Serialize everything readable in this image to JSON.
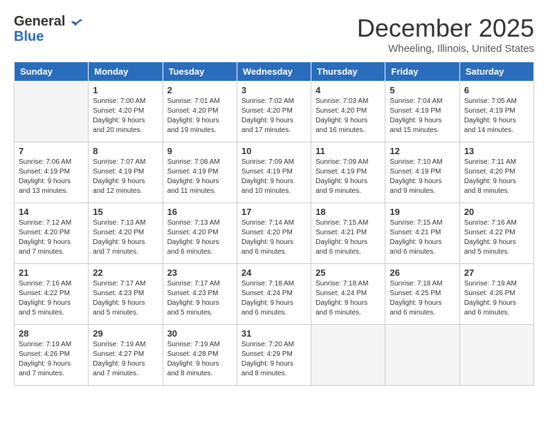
{
  "logo": {
    "general": "General",
    "blue": "Blue"
  },
  "title": "December 2025",
  "location": "Wheeling, Illinois, United States",
  "days_of_week": [
    "Sunday",
    "Monday",
    "Tuesday",
    "Wednesday",
    "Thursday",
    "Friday",
    "Saturday"
  ],
  "weeks": [
    [
      {
        "day": "",
        "empty": true
      },
      {
        "day": "1",
        "sunrise": "7:00 AM",
        "sunset": "4:20 PM",
        "daylight": "9 hours and 20 minutes."
      },
      {
        "day": "2",
        "sunrise": "7:01 AM",
        "sunset": "4:20 PM",
        "daylight": "9 hours and 19 minutes."
      },
      {
        "day": "3",
        "sunrise": "7:02 AM",
        "sunset": "4:20 PM",
        "daylight": "9 hours and 17 minutes."
      },
      {
        "day": "4",
        "sunrise": "7:03 AM",
        "sunset": "4:20 PM",
        "daylight": "9 hours and 16 minutes."
      },
      {
        "day": "5",
        "sunrise": "7:04 AM",
        "sunset": "4:19 PM",
        "daylight": "9 hours and 15 minutes."
      },
      {
        "day": "6",
        "sunrise": "7:05 AM",
        "sunset": "4:19 PM",
        "daylight": "9 hours and 14 minutes."
      }
    ],
    [
      {
        "day": "7",
        "sunrise": "7:06 AM",
        "sunset": "4:19 PM",
        "daylight": "9 hours and 13 minutes."
      },
      {
        "day": "8",
        "sunrise": "7:07 AM",
        "sunset": "4:19 PM",
        "daylight": "9 hours and 12 minutes."
      },
      {
        "day": "9",
        "sunrise": "7:08 AM",
        "sunset": "4:19 PM",
        "daylight": "9 hours and 11 minutes."
      },
      {
        "day": "10",
        "sunrise": "7:09 AM",
        "sunset": "4:19 PM",
        "daylight": "9 hours and 10 minutes."
      },
      {
        "day": "11",
        "sunrise": "7:09 AM",
        "sunset": "4:19 PM",
        "daylight": "9 hours and 9 minutes."
      },
      {
        "day": "12",
        "sunrise": "7:10 AM",
        "sunset": "4:19 PM",
        "daylight": "9 hours and 9 minutes."
      },
      {
        "day": "13",
        "sunrise": "7:11 AM",
        "sunset": "4:20 PM",
        "daylight": "9 hours and 8 minutes."
      }
    ],
    [
      {
        "day": "14",
        "sunrise": "7:12 AM",
        "sunset": "4:20 PM",
        "daylight": "9 hours and 7 minutes."
      },
      {
        "day": "15",
        "sunrise": "7:13 AM",
        "sunset": "4:20 PM",
        "daylight": "9 hours and 7 minutes."
      },
      {
        "day": "16",
        "sunrise": "7:13 AM",
        "sunset": "4:20 PM",
        "daylight": "9 hours and 6 minutes."
      },
      {
        "day": "17",
        "sunrise": "7:14 AM",
        "sunset": "4:20 PM",
        "daylight": "9 hours and 6 minutes."
      },
      {
        "day": "18",
        "sunrise": "7:15 AM",
        "sunset": "4:21 PM",
        "daylight": "9 hours and 6 minutes."
      },
      {
        "day": "19",
        "sunrise": "7:15 AM",
        "sunset": "4:21 PM",
        "daylight": "9 hours and 6 minutes."
      },
      {
        "day": "20",
        "sunrise": "7:16 AM",
        "sunset": "4:22 PM",
        "daylight": "9 hours and 5 minutes."
      }
    ],
    [
      {
        "day": "21",
        "sunrise": "7:16 AM",
        "sunset": "4:22 PM",
        "daylight": "9 hours and 5 minutes."
      },
      {
        "day": "22",
        "sunrise": "7:17 AM",
        "sunset": "4:23 PM",
        "daylight": "9 hours and 5 minutes."
      },
      {
        "day": "23",
        "sunrise": "7:17 AM",
        "sunset": "4:23 PM",
        "daylight": "9 hours and 5 minutes."
      },
      {
        "day": "24",
        "sunrise": "7:18 AM",
        "sunset": "4:24 PM",
        "daylight": "9 hours and 6 minutes."
      },
      {
        "day": "25",
        "sunrise": "7:18 AM",
        "sunset": "4:24 PM",
        "daylight": "9 hours and 6 minutes."
      },
      {
        "day": "26",
        "sunrise": "7:18 AM",
        "sunset": "4:25 PM",
        "daylight": "9 hours and 6 minutes."
      },
      {
        "day": "27",
        "sunrise": "7:19 AM",
        "sunset": "4:26 PM",
        "daylight": "9 hours and 6 minutes."
      }
    ],
    [
      {
        "day": "28",
        "sunrise": "7:19 AM",
        "sunset": "4:26 PM",
        "daylight": "9 hours and 7 minutes."
      },
      {
        "day": "29",
        "sunrise": "7:19 AM",
        "sunset": "4:27 PM",
        "daylight": "9 hours and 7 minutes."
      },
      {
        "day": "30",
        "sunrise": "7:19 AM",
        "sunset": "4:28 PM",
        "daylight": "9 hours and 8 minutes."
      },
      {
        "day": "31",
        "sunrise": "7:20 AM",
        "sunset": "4:29 PM",
        "daylight": "9 hours and 8 minutes."
      },
      {
        "day": "",
        "empty": true
      },
      {
        "day": "",
        "empty": true
      },
      {
        "day": "",
        "empty": true
      }
    ]
  ],
  "labels": {
    "sunrise_prefix": "Sunrise: ",
    "sunset_prefix": "Sunset: ",
    "daylight_prefix": "Daylight: "
  }
}
